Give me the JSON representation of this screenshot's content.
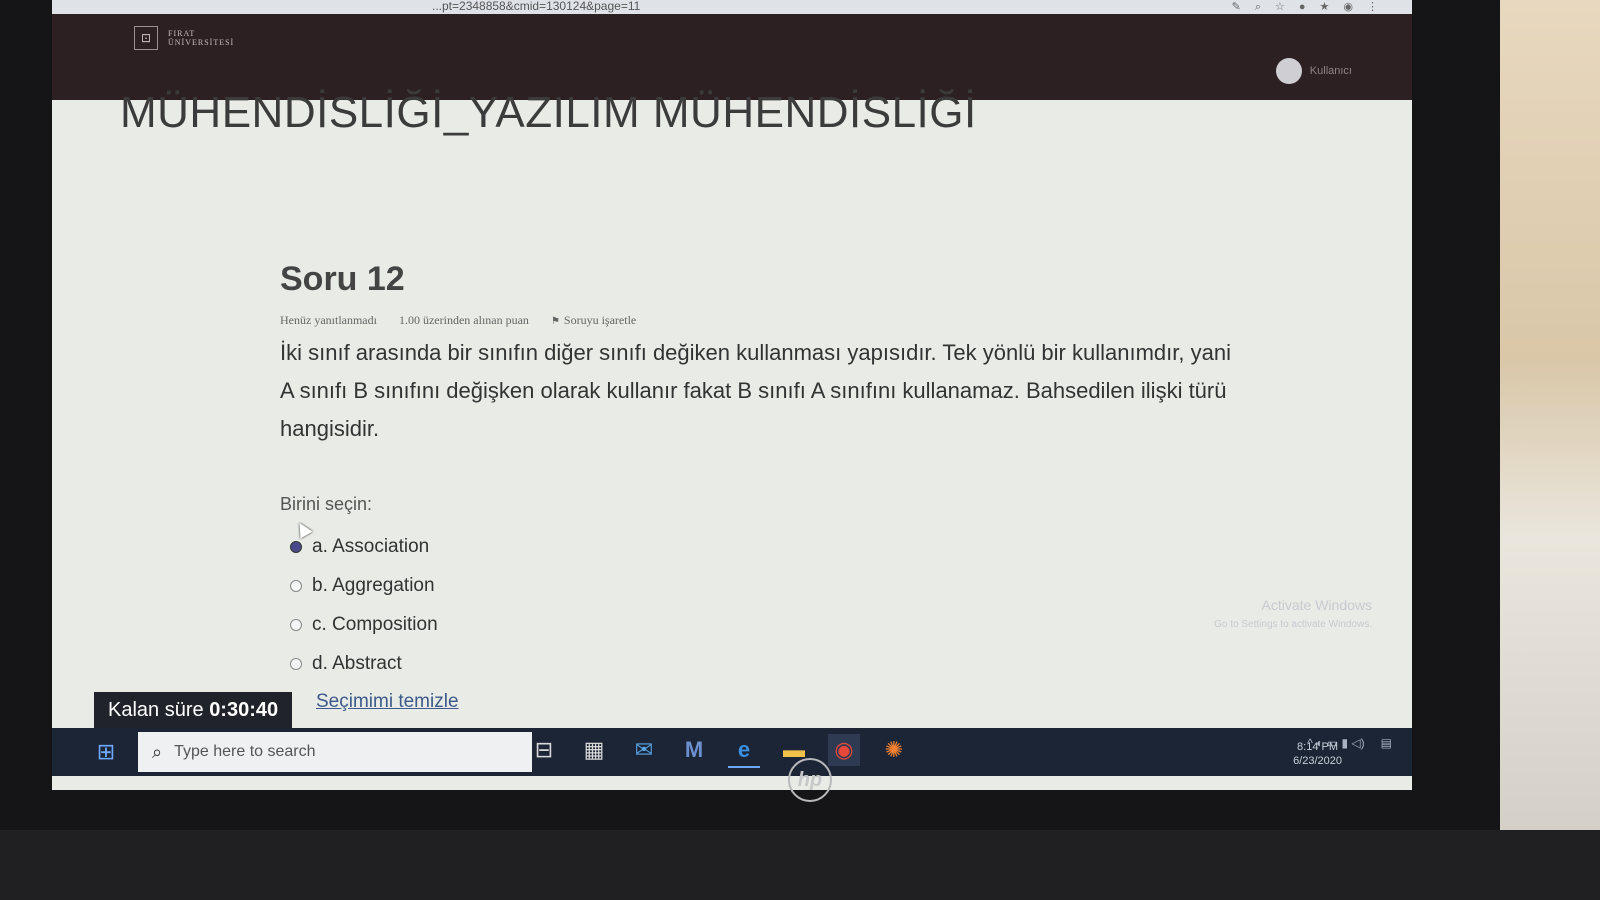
{
  "browser": {
    "url_fragment": "...pt=2348858&cmid=130124&page=11"
  },
  "site": {
    "logo_line1": "FIRAT",
    "logo_line2": "ÜNİVERSİTESİ",
    "user_label": "Kullanıcı"
  },
  "course": {
    "title": "MÜHENDİSLİĞİ_YAZILIM MÜHENDİSLİĞİ"
  },
  "question": {
    "number": "Soru 12",
    "status": "Henüz yanıtlanmadı",
    "points": "1.00 üzerinden alınan puan",
    "flag_label": "Soruyu işaretle",
    "text": "İki sınıf arasında bir sınıfın diğer sınıfı değiken kullanması yapısıdır. Tek yönlü bir kullanımdır, yani A sınıfı B sınıfını değişken olarak kullanır fakat B sınıfı A sınıfını kullanamaz. Bahsedilen ilişki türü hangisidir.",
    "prompt": "Birini seçin:",
    "answers": [
      {
        "label": "a. Association",
        "checked": true
      },
      {
        "label": "b. Aggregation",
        "checked": false
      },
      {
        "label": "c. Composition",
        "checked": false
      },
      {
        "label": "d. Abstract",
        "checked": false
      }
    ],
    "clear_label": "Seçimimi temizle"
  },
  "timer": {
    "label": "Kalan süre",
    "value": "0:30:40"
  },
  "watermark": {
    "line1": "Activate Windows",
    "line2": "Go to Settings to activate Windows."
  },
  "taskbar": {
    "search_placeholder": "Type here to search",
    "clock_time": "8:14 PM",
    "clock_date": "6/23/2020"
  }
}
